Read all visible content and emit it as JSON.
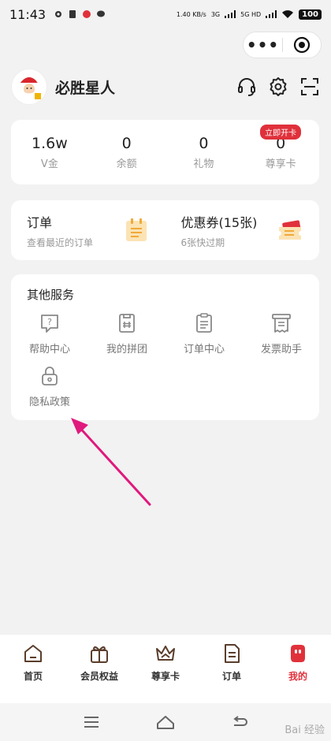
{
  "status": {
    "time": "11:43",
    "net_speed": "1.40 KB/s",
    "signal1": "3G",
    "signal2": "5G HD",
    "battery": "100"
  },
  "profile": {
    "username": "必胜星人"
  },
  "stats": [
    {
      "value": "1.6w",
      "label": "V金"
    },
    {
      "value": "0",
      "label": "余额"
    },
    {
      "value": "0",
      "label": "礼物"
    },
    {
      "value": "0",
      "label": "尊享卡",
      "badge": "立即开卡"
    }
  ],
  "orders": {
    "title": "订单",
    "subtitle": "查看最近的订单"
  },
  "coupons": {
    "title": "优惠券(15张)",
    "subtitle": "6张快过期"
  },
  "services": {
    "title": "其他服务",
    "items": [
      {
        "label": "帮助中心",
        "icon": "help-icon"
      },
      {
        "label": "我的拼团",
        "icon": "group-buy-icon"
      },
      {
        "label": "订单中心",
        "icon": "order-center-icon"
      },
      {
        "label": "发票助手",
        "icon": "invoice-icon"
      },
      {
        "label": "隐私政策",
        "icon": "lock-icon"
      }
    ]
  },
  "tabs": [
    {
      "label": "首页",
      "icon": "home-icon"
    },
    {
      "label": "会员权益",
      "icon": "gift-icon"
    },
    {
      "label": "尊享卡",
      "icon": "crown-icon"
    },
    {
      "label": "订单",
      "icon": "order-icon"
    },
    {
      "label": "我的",
      "icon": "mine-icon",
      "active": true
    }
  ],
  "watermark": "Bai 经验",
  "colors": {
    "accent": "#e0313b",
    "background": "#f2f2f2",
    "arrow": "#e0197d"
  }
}
